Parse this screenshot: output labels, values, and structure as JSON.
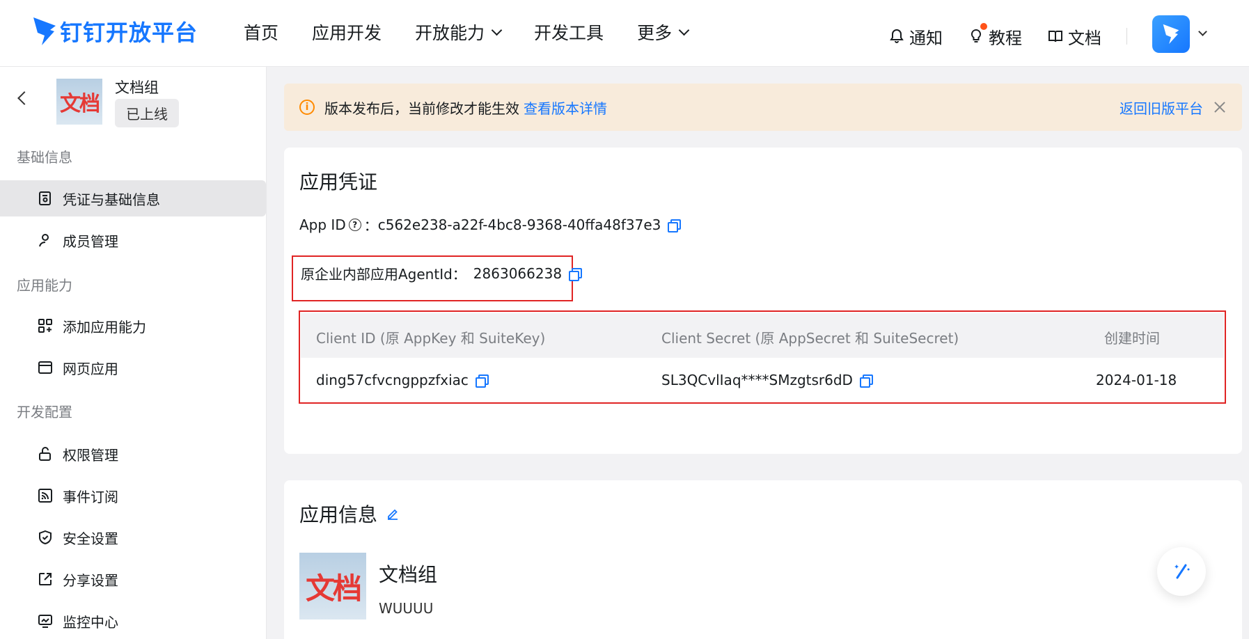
{
  "brand": {
    "name": "钉钉开放平台",
    "color": "#1677ff"
  },
  "nav": {
    "items": [
      {
        "label": "首页"
      },
      {
        "label": "应用开发"
      },
      {
        "label": "开放能力"
      },
      {
        "label": "开发工具"
      },
      {
        "label": "更多"
      }
    ]
  },
  "topRight": {
    "notify": "通知",
    "tutorial": "教程",
    "docs": "文档"
  },
  "sidebar": {
    "appName": "文档组",
    "appThumbText": "文档",
    "status": "已上线",
    "groups": [
      {
        "title": "基础信息",
        "items": [
          {
            "label": "凭证与基础信息",
            "icon": "credential-icon"
          },
          {
            "label": "成员管理",
            "icon": "user-icon"
          }
        ]
      },
      {
        "title": "应用能力",
        "items": [
          {
            "label": "添加应用能力",
            "icon": "grid-add-icon"
          },
          {
            "label": "网页应用",
            "icon": "browser-icon"
          }
        ]
      },
      {
        "title": "开发配置",
        "items": [
          {
            "label": "权限管理",
            "icon": "lock-icon"
          },
          {
            "label": "事件订阅",
            "icon": "rss-icon"
          },
          {
            "label": "安全设置",
            "icon": "shield-icon"
          },
          {
            "label": "分享设置",
            "icon": "share-icon"
          },
          {
            "label": "监控中心",
            "icon": "monitor-icon"
          }
        ]
      }
    ]
  },
  "notice": {
    "text": "版本发布后，当前修改才能生效",
    "link": "查看版本详情",
    "right": "返回旧版平台"
  },
  "credentials": {
    "title": "应用凭证",
    "appIdLabel": "App ID",
    "appIdColon": "：",
    "appId": "c562e238-a22f-4bc8-9368-40ffa48f37e3",
    "agentIdLabel": "原企业内部应用AgentId：",
    "agentId": "2863066238",
    "table": {
      "headers": [
        "Client ID (原 AppKey 和 SuiteKey)",
        "Client Secret (原 AppSecret 和 SuiteSecret)",
        "创建时间"
      ],
      "row": [
        "ding57cfvcngppzfxiac",
        "SL3QCvlIaq****SMzgtsr6dD",
        "2024-01-18"
      ]
    }
  },
  "appInfo": {
    "title": "应用信息",
    "logoText": "文档",
    "name": "文档组",
    "desc": "WUUUU"
  },
  "colors": {
    "accent": "#1677ff",
    "highlight": "#e02424",
    "noticeBg": "#f8ebdb",
    "noticeIcon": "#ff8a00"
  }
}
